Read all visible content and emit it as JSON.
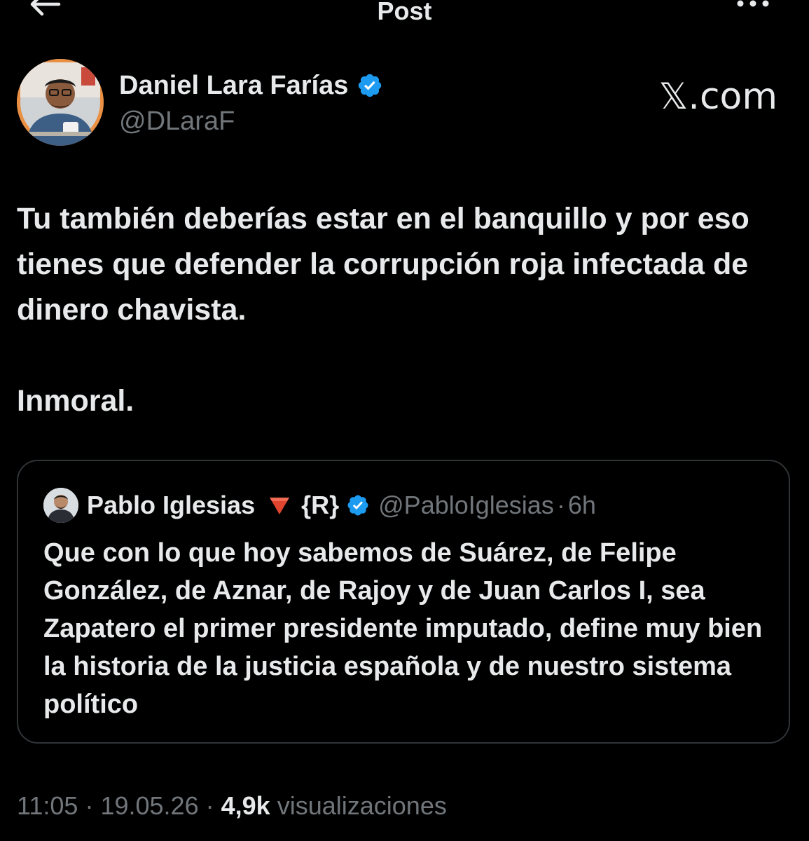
{
  "header": {
    "title": "Post",
    "back_icon": "arrow-left-icon",
    "more_icon": "more-horizontal-icon"
  },
  "author": {
    "name": "Daniel Lara Farías",
    "handle": "@DLaraF",
    "verified": true,
    "verified_color": "#1d9bf0",
    "avatar_ring_color": "#e99045"
  },
  "watermark": "𝕏.com",
  "post": {
    "paragraph1": "Tu también deberías estar en el banquillo y por eso tienes que defender la corrupción roja infectada de dinero chavista.",
    "paragraph2": "Inmoral."
  },
  "quote": {
    "name": "Pablo Iglesias",
    "emoji": "red-triangle-icon",
    "tag": "{R}",
    "verified": true,
    "handle": "@PabloIglesias",
    "separator": "·",
    "time": "6h",
    "text": "Que con lo que hoy sabemos de Suárez, de Felipe González, de Aznar, de Rajoy y de Juan Carlos I, sea Zapatero el primer presidente imputado, define muy bien la historia de la justicia española y de nuestro sistema político"
  },
  "meta": {
    "time": "11:05",
    "separator": "·",
    "date": "19.05.26",
    "views_count": "4,9k",
    "views_label": "visualizaciones"
  },
  "colors": {
    "background": "#000000",
    "text_primary": "#e7e9ea",
    "text_secondary": "#71767b",
    "border": "#2f3336",
    "accent": "#1d9bf0"
  }
}
